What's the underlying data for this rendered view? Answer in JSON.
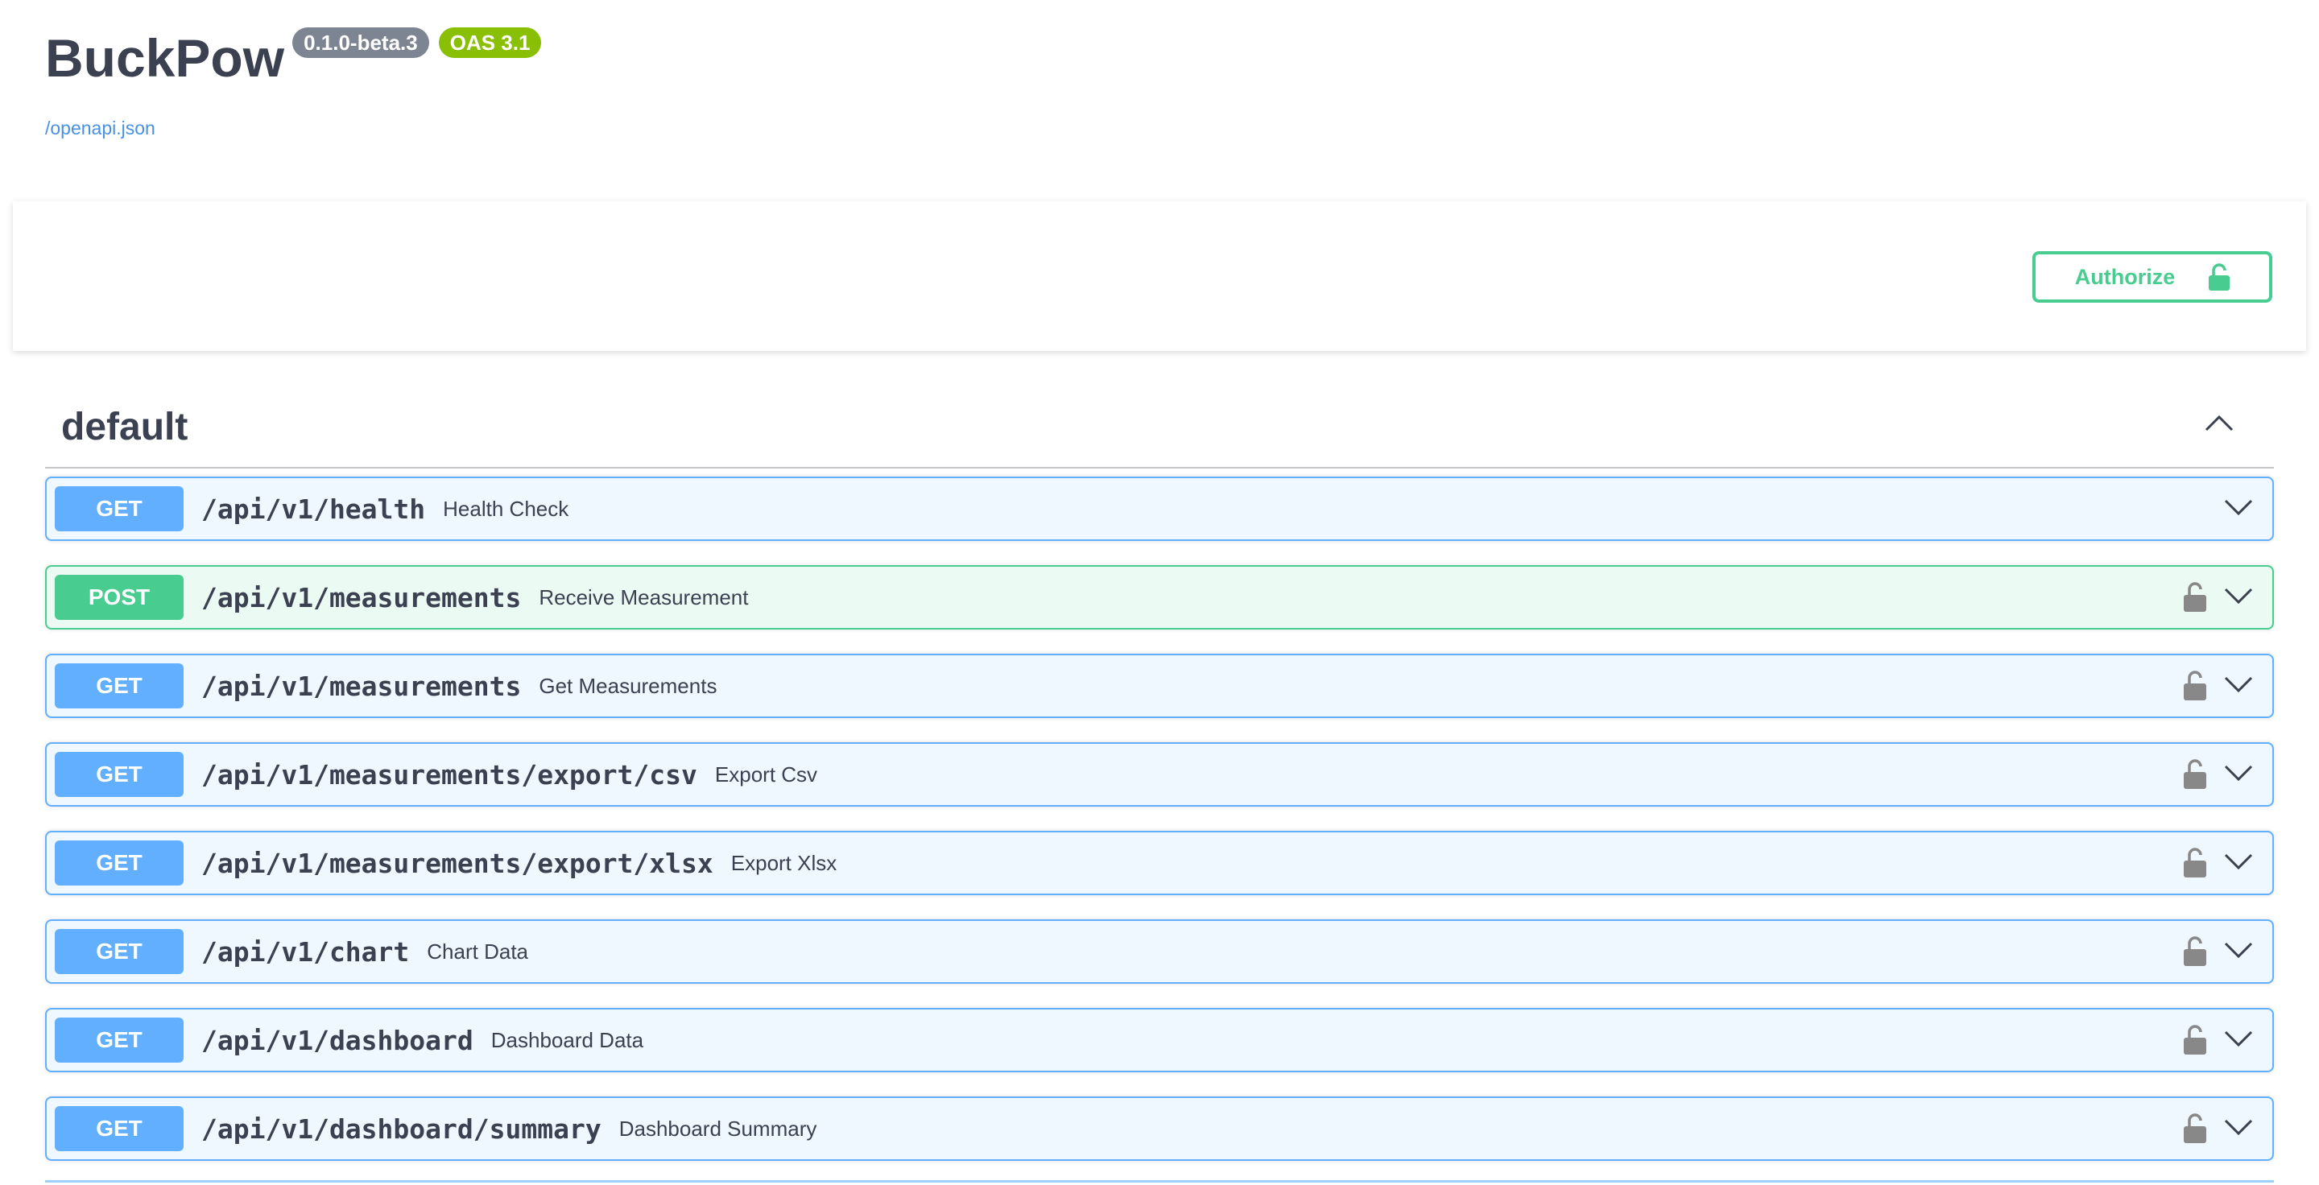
{
  "info": {
    "title": "BuckPow",
    "version_badge": "0.1.0-beta.3",
    "oas_badge": "OAS 3.1",
    "spec_link": "/openapi.json"
  },
  "auth": {
    "authorize_label": "Authorize",
    "icon": "unlock-icon"
  },
  "tag": {
    "name": "default",
    "toggle_icon": "chevron-up-icon"
  },
  "colors": {
    "get": "#61afe",
    "post": "#49cc90",
    "text": "#3b4151",
    "link": "#4990e2"
  },
  "operations": [
    {
      "method": "GET",
      "path": "/api/v1/health",
      "summary": "Health Check",
      "locked": false
    },
    {
      "method": "POST",
      "path": "/api/v1/measurements",
      "summary": "Receive Measurement",
      "locked": true
    },
    {
      "method": "GET",
      "path": "/api/v1/measurements",
      "summary": "Get Measurements",
      "locked": true
    },
    {
      "method": "GET",
      "path": "/api/v1/measurements/export/csv",
      "summary": "Export Csv",
      "locked": true
    },
    {
      "method": "GET",
      "path": "/api/v1/measurements/export/xlsx",
      "summary": "Export Xlsx",
      "locked": true
    },
    {
      "method": "GET",
      "path": "/api/v1/chart",
      "summary": "Chart Data",
      "locked": true
    },
    {
      "method": "GET",
      "path": "/api/v1/dashboard",
      "summary": "Dashboard Data",
      "locked": true
    },
    {
      "method": "GET",
      "path": "/api/v1/dashboard/summary",
      "summary": "Dashboard Summary",
      "locked": true
    }
  ]
}
